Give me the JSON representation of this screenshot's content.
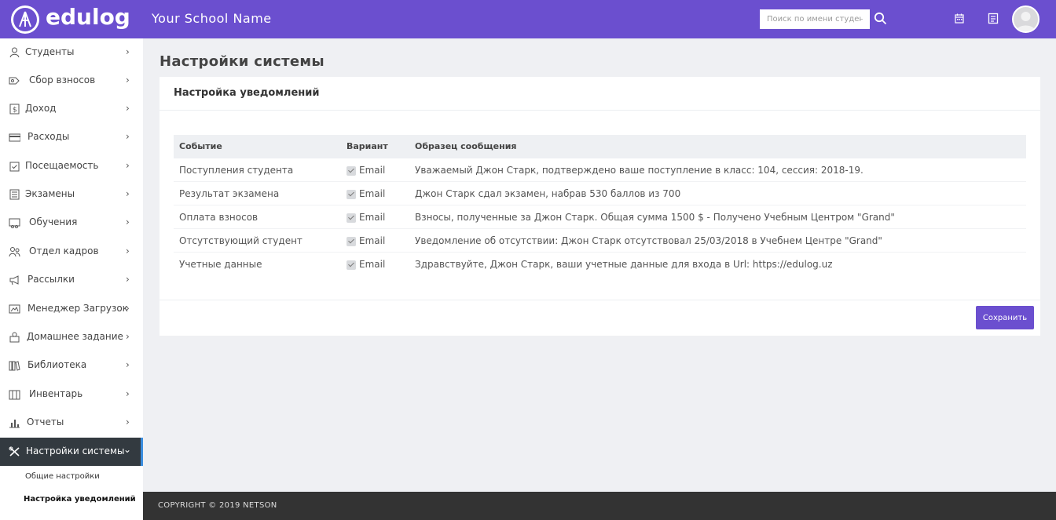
{
  "header": {
    "logo_text": "edulog",
    "school_name": "Your School Name",
    "search_placeholder": "Поиск по имени студента",
    "brand_color": "#6b4fcf"
  },
  "sidebar": {
    "items": [
      {
        "label": "Студенты",
        "icon": "students-icon"
      },
      {
        "label": "Сбор взносов",
        "icon": "fees-icon"
      },
      {
        "label": "Доход",
        "icon": "income-icon"
      },
      {
        "label": "Расходы",
        "icon": "expenses-icon"
      },
      {
        "label": "Посещаемость",
        "icon": "attendance-icon"
      },
      {
        "label": "Экзамены",
        "icon": "exams-icon"
      },
      {
        "label": "Обучения",
        "icon": "training-icon"
      },
      {
        "label": "Отдел кадров",
        "icon": "hr-icon"
      },
      {
        "label": "Рассылки",
        "icon": "megaphone-icon"
      },
      {
        "label": "Менеджер Загрузок",
        "icon": "downloads-icon"
      },
      {
        "label": "Домашнее задание",
        "icon": "homework-icon"
      },
      {
        "label": "Библиотека",
        "icon": "library-icon"
      },
      {
        "label": "Инвентарь",
        "icon": "inventory-icon"
      },
      {
        "label": "Отчеты",
        "icon": "reports-icon"
      },
      {
        "label": "Настройки системы",
        "icon": "settings-icon",
        "active": true
      }
    ],
    "sub_items": [
      {
        "label": "Общие настройки"
      },
      {
        "label": "Настройка уведомлений",
        "current": true
      }
    ]
  },
  "main": {
    "page_title": "Настройки системы",
    "card_title": "Настройка уведомлений",
    "columns": [
      "Событие",
      "Вариант",
      "Образец сообщения"
    ],
    "rows": [
      {
        "event": "Поступления студента",
        "variant": "Email",
        "checked": true,
        "message": "Уважаемый Джон Старк, подтверждено ваше поступление в класс: 104, сессия: 2018-19."
      },
      {
        "event": "Результат экзамена",
        "variant": "Email",
        "checked": true,
        "message": "Джон Старк сдал экзамен, набрав 530 баллов из 700"
      },
      {
        "event": "Оплата взносов",
        "variant": "Email",
        "checked": true,
        "message": "Взносы, полученные за Джон Старк. Общая сумма 1500 $ - Получено Учебным Центром \"Grand\""
      },
      {
        "event": "Отсутствующий студент",
        "variant": "Email",
        "checked": true,
        "message": "Уведомление об отсутствии: Джон Старк отсутствовал 25/03/2018 в Учебнем Центре \"Grand\""
      },
      {
        "event": "Учетные данные",
        "variant": "Email",
        "checked": true,
        "message": "Здравствуйте, Джон Старк, ваши учетные данные для входа в Url: https://edulog.uz"
      }
    ],
    "save_label": "Сохранить"
  },
  "footer": {
    "copyright": "COPYRIGHT © 2019 NETSON"
  }
}
